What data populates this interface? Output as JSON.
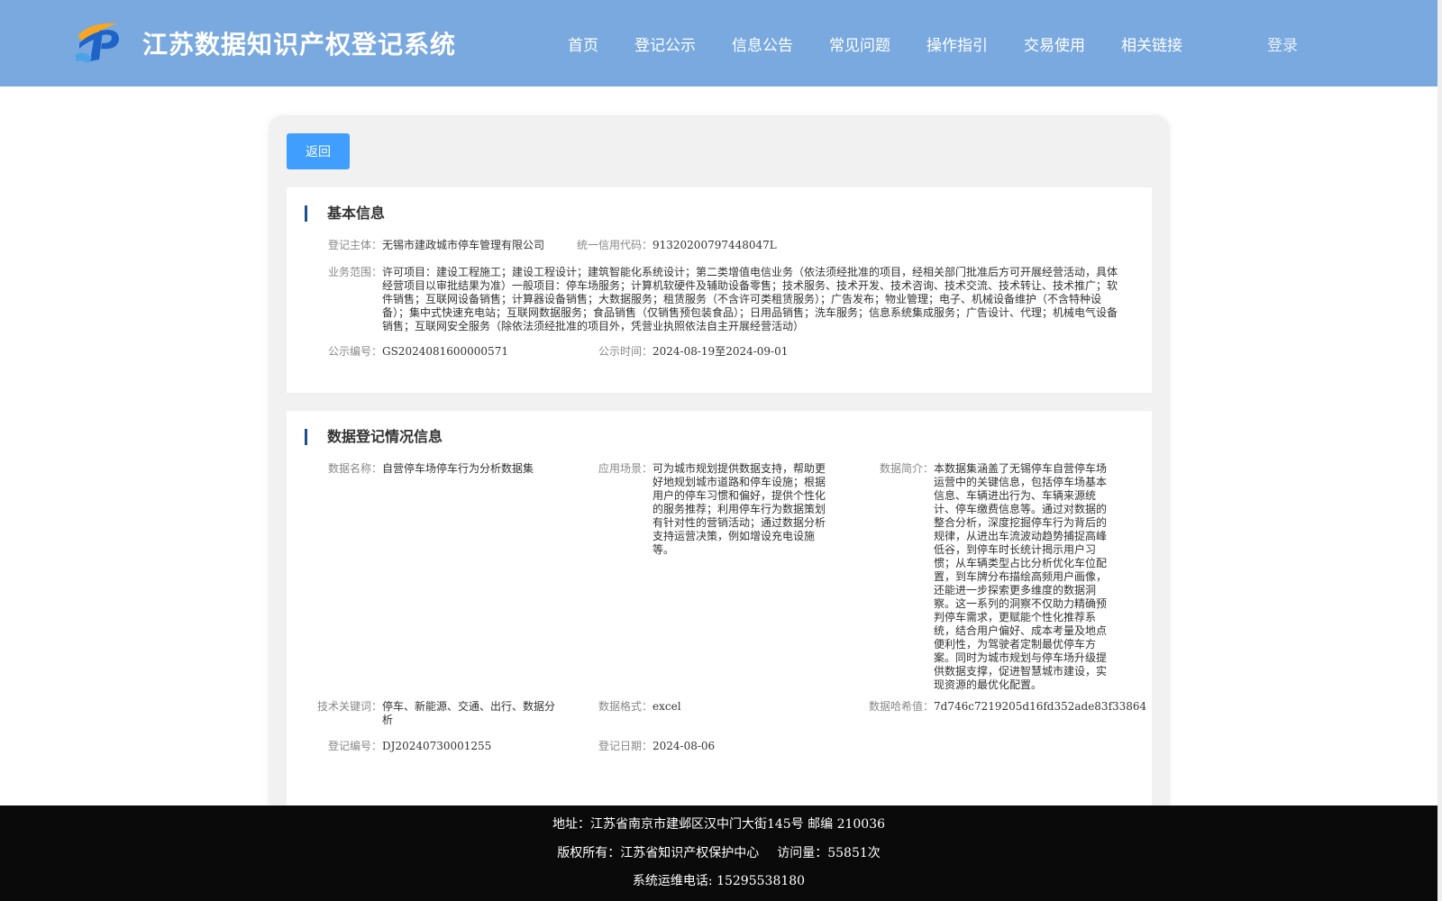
{
  "header": {
    "site_title": "江苏数据知识产权登记系统",
    "nav": [
      "首页",
      "登记公示",
      "信息公告",
      "常见问题",
      "操作指引",
      "交易使用",
      "相关链接"
    ],
    "login": "登录",
    "bg_color": "#79a9df"
  },
  "back_button": "返回",
  "basic_info": {
    "title": "基本信息",
    "subject_label": "登记主体：",
    "subject": "无锡市建政城市停车管理有限公司",
    "credit_code_label": "统一信用代码：",
    "credit_code": "91320200797448047L",
    "business_scope_label": "业务范围：",
    "business_scope": "许可项目：建设工程施工；建设工程设计；建筑智能化系统设计；第二类增值电信业务（依法须经批准的项目，经相关部门批准后方可开展经营活动，具体经营项目以审批结果为准）一般项目：停车场服务；计算机软硬件及辅助设备零售；技术服务、技术开发、技术咨询、技术交流、技术转让、技术推广；软件销售；互联网设备销售；计算器设备销售；大数据服务；租赁服务（不含许可类租赁服务）；广告发布；物业管理；电子、机械设备维护（不含特种设备）；集中式快速充电站；互联网数据服务；食品销售（仅销售预包装食品）；日用品销售；洗车服务；信息系统集成服务；广告设计、代理；机械电气设备销售；互联网安全服务（除依法须经批准的项目外，凭营业执照依法自主开展经营活动）",
    "notice_no_label": "公示编号：",
    "notice_no": "GS2024081600000571",
    "notice_time_label": "公示时间：",
    "notice_time": "2024-08-19至2024-09-01"
  },
  "data_info": {
    "title": "数据登记情况信息",
    "name_label": "数据名称：",
    "name": "自营停车场停车行为分析数据集",
    "scenario_label": "应用场景：",
    "scenario": "可为城市规划提供数据支持，帮助更好地规划城市道路和停车设施；根据用户的停车习惯和偏好，提供个性化的服务推荐；利用停车行为数据策划有针对性的营销活动；通过数据分析支持运营决策，例如增设充电设施等。",
    "intro_label": "数据简介：",
    "intro": "本数据集涵盖了无锡停车自营停车场运营中的关键信息，包括停车场基本信息、车辆进出行为、车辆来源统计、停车缴费信息等。通过对数据的整合分析，深度挖掘停车行为背后的规律，从进出车流波动趋势捕捉高峰低谷，到停车时长统计揭示用户习惯；从车辆类型占比分析优化车位配置，到车牌分布描绘高频用户画像，还能进一步探索更多维度的数据洞察。这一系列的洞察不仅助力精确预判停车需求，更赋能个性化推荐系统，结合用户偏好、成本考量及地点便利性，为驾驶者定制最优停车方案。同时为城市规划与停车场升级提供数据支撑，促进智慧城市建设，实现资源的最优化配置。",
    "keywords_label": "技术关键词：",
    "keywords": "停车、新能源、交通、出行、数据分析",
    "format_label": "数据格式：",
    "format": "excel",
    "hash_label": "数据哈希值：",
    "hash": "7d746c7219205d16fd352ade83f33864",
    "reg_no_label": "登记编号：",
    "reg_no": "DJ20240730001255",
    "reg_date_label": "登记日期：",
    "reg_date": "2024-08-06"
  },
  "footer": {
    "address": "地址：江苏省南京市建邺区汉中门大街145号 邮编 210036",
    "copyright": "版权所有：江苏省知识产权保护中心",
    "visits": "访问量：55851次",
    "phone": "系统运维电话: 15295538180"
  }
}
